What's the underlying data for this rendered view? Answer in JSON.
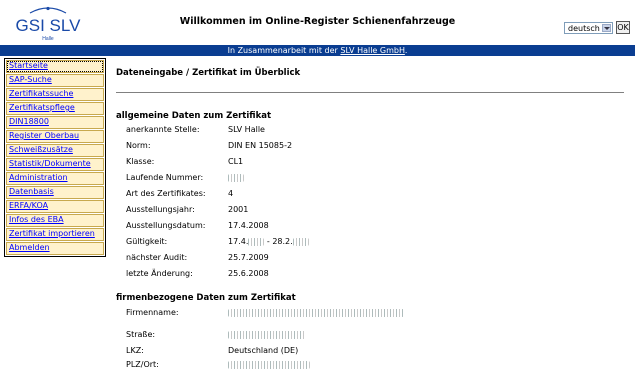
{
  "header": {
    "logo_text": "GSI SLV",
    "logo_sub": "Halle",
    "title": "Willkommen im Online-Register Schienenfahrzeuge",
    "language": "deutsch",
    "ok_label": "OK"
  },
  "banner": {
    "text": "In Zusammenarbeit mit der ",
    "link": "SLV Halle GmbH",
    "suffix": "."
  },
  "sidebar": {
    "items": [
      {
        "label": "Startseite"
      },
      {
        "label": "SAP-Suche"
      },
      {
        "label": "Zertifikatssuche"
      },
      {
        "label": "Zertifikatspflege"
      },
      {
        "label": "DIN18800"
      },
      {
        "label": "Register Oberbau"
      },
      {
        "label": "Schweißzusätze"
      },
      {
        "label": "Statistik/Dokumente"
      },
      {
        "label": "Administration"
      },
      {
        "label": "Datenbasis"
      },
      {
        "label": "ERFA/KOA"
      },
      {
        "label": "Infos des EBA"
      },
      {
        "label": "Zertifikat importieren"
      },
      {
        "label": "Abmelden"
      }
    ]
  },
  "main": {
    "title": "Dateneingabe / Zertifikat im Überblick",
    "section1": {
      "title": "allgemeine Daten zum Zertifikat",
      "rows": [
        {
          "label": "anerkannte Stelle:",
          "value": "SLV Halle"
        },
        {
          "label": "Norm:",
          "value": "DIN EN 15085-2"
        },
        {
          "label": "Klasse:",
          "value": "CL1"
        },
        {
          "label": "Laufende Nummer:",
          "value": ""
        },
        {
          "label": "Art des Zertifikates:",
          "value": "4"
        },
        {
          "label": "Ausstellungsjahr:",
          "value": "2001"
        },
        {
          "label": "Ausstellungsdatum:",
          "value": "17.4.2008"
        },
        {
          "label": "Gültigkeit:",
          "value": "17.4.",
          "value_mid": " - 28.2."
        },
        {
          "label": "nächster Audit:",
          "value": "25.7.2009"
        },
        {
          "label": "letzte Änderung:",
          "value": "25.6.2008"
        }
      ]
    },
    "section2": {
      "title": "firmenbezogene Daten zum Zertifikat",
      "rows": [
        {
          "label": "Firmenname:",
          "value": ""
        },
        {
          "label": "Straße:",
          "value": ""
        },
        {
          "label": "LKZ:",
          "value": "Deutschland (DE)"
        },
        {
          "label": "PLZ/Ort:",
          "value": ""
        }
      ]
    }
  }
}
